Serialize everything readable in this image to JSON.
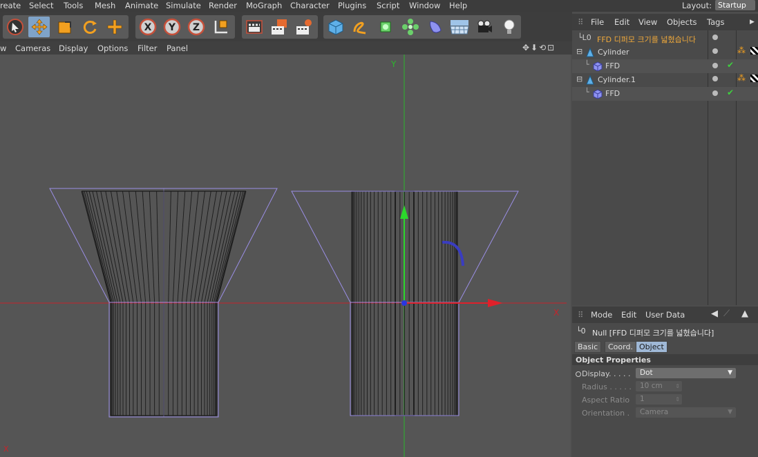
{
  "menubar": {
    "items": [
      "reate",
      "Select",
      "Tools",
      "Mesh",
      "Animate",
      "Simulate",
      "Render",
      "MoGraph",
      "Character",
      "Plugins",
      "Script",
      "Window",
      "Help"
    ],
    "layout_label": "Layout:",
    "layout_value": "Startup"
  },
  "viewport_menu": {
    "items": [
      "w",
      "Cameras",
      "Display",
      "Options",
      "Filter",
      "Panel"
    ],
    "nav_icons": "✥⬇⟲⊡"
  },
  "viewport": {
    "axis_y_label": "Y",
    "axis_x_label": "X",
    "corner_label": "X"
  },
  "object_manager": {
    "menu": [
      "File",
      "Edit",
      "View",
      "Objects",
      "Tags"
    ],
    "items": [
      {
        "name": "FFD 디퍼모 크기를 넓혔습니다",
        "type": "null",
        "highlight": true
      },
      {
        "name": "Cylinder",
        "type": "cylinder"
      },
      {
        "name": "FFD",
        "type": "ffd"
      },
      {
        "name": "Cylinder.1",
        "type": "cylinder"
      },
      {
        "name": "FFD",
        "type": "ffd"
      }
    ]
  },
  "attributes": {
    "menu": [
      "Mode",
      "Edit",
      "User Data"
    ],
    "title": "Null [FFD 디퍼모 크기를 넓혔습니다]",
    "tabs": [
      "Basic",
      "Coord.",
      "Object"
    ],
    "active_tab": "Object",
    "section": "Object Properties",
    "props": [
      {
        "label": "Display. . . . .",
        "value": "Dot",
        "enabled": true
      },
      {
        "label": "Radius . . . . .",
        "value": "10 cm",
        "enabled": false
      },
      {
        "label": "Aspect Ratio",
        "value": "1",
        "enabled": false
      },
      {
        "label": "Orientation .",
        "value": "Camera",
        "enabled": false
      }
    ]
  },
  "colors": {
    "accent": "#7fa3c8",
    "axis_x": "#d0202a",
    "axis_y": "#2bb82b",
    "cage": "#9b8fe6",
    "highlight_text": "#f0a93a"
  }
}
